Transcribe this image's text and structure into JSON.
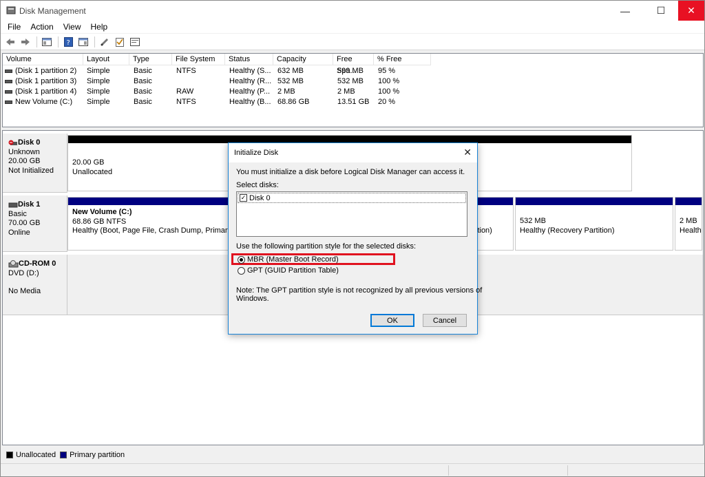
{
  "window": {
    "title": "Disk Management",
    "minimize": "—",
    "maximize": "☐",
    "close": "✕"
  },
  "menu": [
    "File",
    "Action",
    "View",
    "Help"
  ],
  "toolbar_icons": [
    "back-icon",
    "forward-icon",
    "console-tree-icon",
    "help-icon",
    "properties-icon",
    "rescan-icon",
    "check-icon",
    "console-icon"
  ],
  "volume_list": {
    "columns": [
      "Volume",
      "Layout",
      "Type",
      "File System",
      "Status",
      "Capacity",
      "Free Spa...",
      "% Free"
    ],
    "rows": [
      [
        "(Disk 1 partition 2)",
        "Simple",
        "Basic",
        "NTFS",
        "Healthy (S...",
        "632 MB",
        "599 MB",
        "95 %"
      ],
      [
        "(Disk 1 partition 3)",
        "Simple",
        "Basic",
        "",
        "Healthy (R...",
        "532 MB",
        "532 MB",
        "100 %"
      ],
      [
        "(Disk 1 partition 4)",
        "Simple",
        "Basic",
        "RAW",
        "Healthy (P...",
        "2 MB",
        "2 MB",
        "100 %"
      ],
      [
        "New Volume (C:)",
        "Simple",
        "Basic",
        "NTFS",
        "Healthy (B...",
        "68.86 GB",
        "13.51 GB",
        "20 %"
      ]
    ]
  },
  "disks": {
    "disk0": {
      "name": "Disk 0",
      "type": "Unknown",
      "size": "20.00 GB",
      "state": "Not Initialized",
      "partition": {
        "size": "20.00 GB",
        "label": "Unallocated"
      }
    },
    "disk1": {
      "name": "Disk 1",
      "type": "Basic",
      "size": "70.00 GB",
      "state": "Online",
      "p1": {
        "name": "New Volume  (C:)",
        "fs": "68.86 GB NTFS",
        "status": "Healthy (Boot, Page File, Crash Dump, Primary P"
      },
      "p2_tail": "ition)",
      "p3": {
        "size": "532 MB",
        "status": "Healthy (Recovery Partition)"
      },
      "p4": {
        "size": "2 MB",
        "status": "Healthy"
      }
    },
    "cdrom0": {
      "name": "CD-ROM 0",
      "drive": "DVD (D:)",
      "media": "No Media"
    }
  },
  "legend": [
    {
      "label": "Unallocated",
      "color": "#000000"
    },
    {
      "label": "Primary partition",
      "color": "#000080"
    }
  ],
  "dialog": {
    "title": "Initialize Disk",
    "intro": "You must initialize a disk before Logical Disk Manager can access it.",
    "select_label": "Select disks:",
    "disk_item": "Disk 0",
    "style_label": "Use the following partition style for the selected disks:",
    "mbr": "MBR (Master Boot Record)",
    "gpt": "GPT (GUID Partition Table)",
    "note1": "Note: The GPT partition style is not recognized by all previous versions of",
    "note2": "Windows.",
    "ok": "OK",
    "cancel": "Cancel"
  },
  "colors": {
    "unallocated": "#000000",
    "primary": "#000080",
    "highlight": "#e0121f",
    "accent": "#0078d7"
  }
}
